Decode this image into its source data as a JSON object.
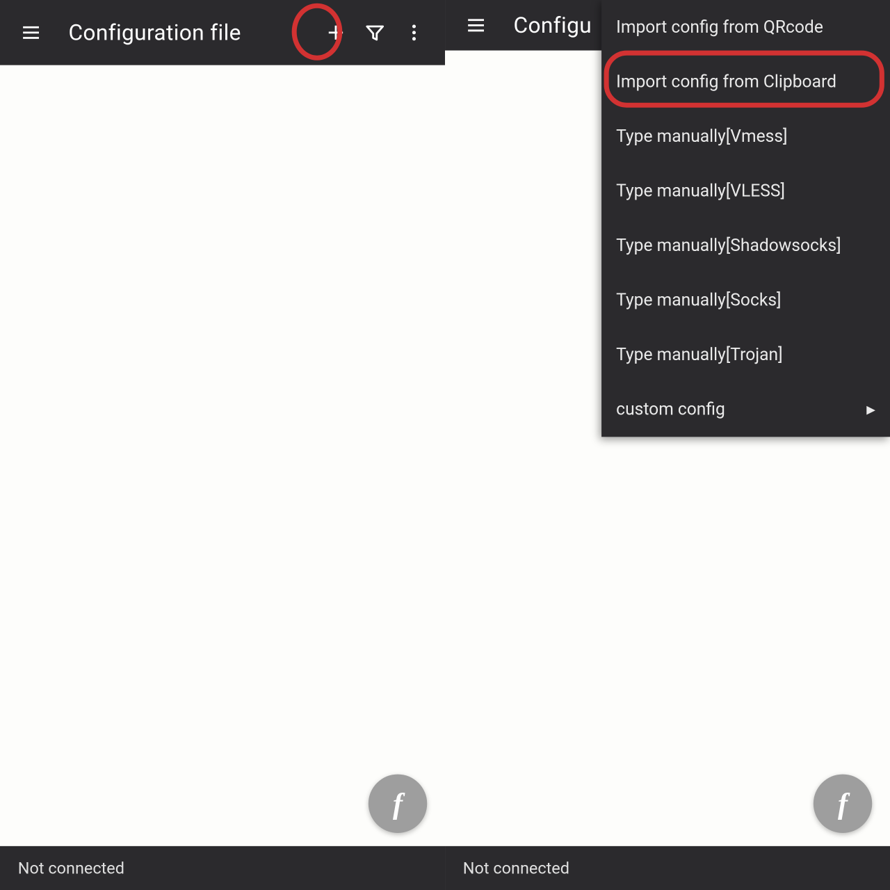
{
  "left": {
    "title": "Configuration file",
    "status": "Not connected",
    "fab": "f"
  },
  "right": {
    "title": "Configu",
    "status": "Not connected",
    "fab": "f",
    "menu": [
      "Import config from QRcode",
      "Import config from Clipboard",
      "Type manually[Vmess]",
      "Type manually[VLESS]",
      "Type manually[Shadowsocks]",
      "Type manually[Socks]",
      "Type manually[Trojan]",
      "custom config"
    ]
  }
}
